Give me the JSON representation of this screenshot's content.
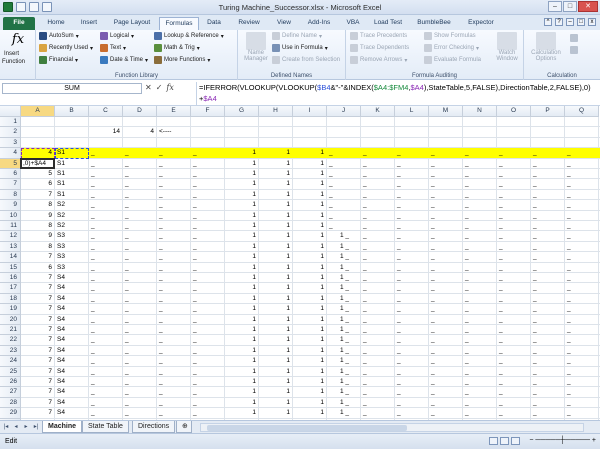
{
  "window": {
    "title": "Turing Machine_Successor.xlsx - Microsoft Excel"
  },
  "tabs": [
    "File",
    "Home",
    "Insert",
    "Page Layout",
    "Formulas",
    "Data",
    "Review",
    "View",
    "Add-Ins",
    "VBA",
    "Load Test",
    "BumbleBee",
    "Expector"
  ],
  "active_tab": "Formulas",
  "ribbon": {
    "insert_function": [
      "Insert",
      "Function"
    ],
    "library": {
      "autosum": "AutoSum",
      "recent": "Recently Used",
      "financial": "Financial",
      "logical": "Logical",
      "text": "Text",
      "datetime": "Date & Time",
      "lookup": "Lookup & Reference",
      "math": "Math & Trig",
      "more": "More Functions",
      "label": "Function Library"
    },
    "names": {
      "name_manager": [
        "Name",
        "Manager"
      ],
      "define_name": "Define Name",
      "use_in_formula": "Use in Formula",
      "create_from_selection": "Create from Selection",
      "label": "Defined Names"
    },
    "auditing": {
      "trace_precedents": "Trace Precedents",
      "trace_dependents": "Trace Dependents",
      "remove_arrows": "Remove Arrows",
      "show_formulas": "Show Formulas",
      "error_checking": "Error Checking",
      "evaluate_formula": "Evaluate Formula",
      "watch_window": [
        "Watch",
        "Window"
      ],
      "label": "Formula Auditing"
    },
    "calculation": {
      "options": [
        "Calculation",
        "Options"
      ],
      "label": "Calculation"
    }
  },
  "formula_bar": {
    "name_box": "SUM",
    "cancel": "✕",
    "enter": "✓",
    "fx": "fx",
    "formula_parts": [
      {
        "text": "=IFERROR(VLOOKUP(VLOOKUP(",
        "color": "black"
      },
      {
        "text": "$B4",
        "color": "blue"
      },
      {
        "text": "&\"-\"&INDEX(",
        "color": "black"
      },
      {
        "text": "$A4:$FM4",
        "color": "green"
      },
      {
        "text": ",",
        "color": "black"
      },
      {
        "text": "$A4",
        "color": "purple"
      },
      {
        "text": "),StateTable,5,FALSE),DirectionTable,2,FALSE),0)+",
        "color": "black"
      },
      {
        "text": "$A4",
        "color": "purple"
      }
    ]
  },
  "grid": {
    "columns": [
      "A",
      "B",
      "C",
      "D",
      "E",
      "F",
      "G",
      "H",
      "I",
      "J",
      "K",
      "L",
      "M",
      "N",
      "O",
      "P",
      "Q"
    ],
    "rows": [
      {
        "n": "1",
        "a": "",
        "b": "",
        "c": "",
        "d": "",
        "e": "",
        "g": "",
        "h": "",
        "i": "",
        "j": "",
        "rest": false
      },
      {
        "n": "2",
        "a": "",
        "b": "",
        "c": "14",
        "d": "4",
        "e": "<----",
        "g": "",
        "h": "",
        "i": "",
        "j": "",
        "rest": false
      },
      {
        "n": "3",
        "a": "",
        "b": "",
        "c": "",
        "d": "",
        "e": "",
        "g": "",
        "h": "",
        "i": "",
        "j": "",
        "rest": false
      },
      {
        "n": "4",
        "a": "4",
        "b": "S1",
        "c": "_",
        "d": "_",
        "e": "_",
        "f": "_",
        "g": "1",
        "h": "1",
        "i": "1",
        "j": "_",
        "rest": true
      },
      {
        "n": "5",
        "a": ",0)+$A4",
        "b": "S1",
        "c": "_",
        "d": "_",
        "e": "_",
        "f": "_",
        "g": "1",
        "h": "1",
        "i": "1",
        "j": "_",
        "rest": true
      },
      {
        "n": "6",
        "a": "5",
        "b": "S1",
        "c": "_",
        "d": "_",
        "e": "_",
        "f": "_",
        "g": "1",
        "h": "1",
        "i": "1",
        "j": "_",
        "rest": true
      },
      {
        "n": "7",
        "a": "6",
        "b": "S1",
        "c": "_",
        "d": "_",
        "e": "_",
        "f": "_",
        "g": "1",
        "h": "1",
        "i": "1",
        "j": "_",
        "rest": true
      },
      {
        "n": "8",
        "a": "7",
        "b": "S1",
        "c": "_",
        "d": "_",
        "e": "_",
        "f": "_",
        "g": "1",
        "h": "1",
        "i": "1",
        "j": "_",
        "rest": true
      },
      {
        "n": "9",
        "a": "8",
        "b": "S2",
        "c": "_",
        "d": "_",
        "e": "_",
        "f": "_",
        "g": "1",
        "h": "1",
        "i": "1",
        "j": "_",
        "rest": true
      },
      {
        "n": "10",
        "a": "9",
        "b": "S2",
        "c": "_",
        "d": "_",
        "e": "_",
        "f": "_",
        "g": "1",
        "h": "1",
        "i": "1",
        "j": "_",
        "rest": true
      },
      {
        "n": "11",
        "a": "8",
        "b": "S2",
        "c": "_",
        "d": "_",
        "e": "_",
        "f": "_",
        "g": "1",
        "h": "1",
        "i": "1",
        "j": "_",
        "rest": true
      },
      {
        "n": "12",
        "a": "9",
        "b": "S3",
        "c": "_",
        "d": "_",
        "e": "_",
        "f": "_",
        "g": "1",
        "h": "1",
        "i": "1",
        "j": "1 _",
        "rest": true
      },
      {
        "n": "13",
        "a": "8",
        "b": "S3",
        "c": "_",
        "d": "_",
        "e": "_",
        "f": "_",
        "g": "1",
        "h": "1",
        "i": "1",
        "j": "1 _",
        "rest": true
      },
      {
        "n": "14",
        "a": "7",
        "b": "S3",
        "c": "_",
        "d": "_",
        "e": "_",
        "f": "_",
        "g": "1",
        "h": "1",
        "i": "1",
        "j": "1 _",
        "rest": true
      },
      {
        "n": "15",
        "a": "6",
        "b": "S3",
        "c": "_",
        "d": "_",
        "e": "_",
        "f": "_",
        "g": "1",
        "h": "1",
        "i": "1",
        "j": "1 _",
        "rest": true
      },
      {
        "n": "16",
        "a": "7",
        "b": "S4",
        "c": "_",
        "d": "_",
        "e": "_",
        "f": "_",
        "g": "1",
        "h": "1",
        "i": "1",
        "j": "1 _",
        "rest": true
      },
      {
        "n": "17",
        "a": "7",
        "b": "S4",
        "c": "_",
        "d": "_",
        "e": "_",
        "f": "_",
        "g": "1",
        "h": "1",
        "i": "1",
        "j": "1 _",
        "rest": true
      },
      {
        "n": "18",
        "a": "7",
        "b": "S4",
        "c": "_",
        "d": "_",
        "e": "_",
        "f": "_",
        "g": "1",
        "h": "1",
        "i": "1",
        "j": "1 _",
        "rest": true
      },
      {
        "n": "19",
        "a": "7",
        "b": "S4",
        "c": "_",
        "d": "_",
        "e": "_",
        "f": "_",
        "g": "1",
        "h": "1",
        "i": "1",
        "j": "1 _",
        "rest": true
      },
      {
        "n": "20",
        "a": "7",
        "b": "S4",
        "c": "_",
        "d": "_",
        "e": "_",
        "f": "_",
        "g": "1",
        "h": "1",
        "i": "1",
        "j": "1 _",
        "rest": true
      },
      {
        "n": "21",
        "a": "7",
        "b": "S4",
        "c": "_",
        "d": "_",
        "e": "_",
        "f": "_",
        "g": "1",
        "h": "1",
        "i": "1",
        "j": "1 _",
        "rest": true
      },
      {
        "n": "22",
        "a": "7",
        "b": "S4",
        "c": "_",
        "d": "_",
        "e": "_",
        "f": "_",
        "g": "1",
        "h": "1",
        "i": "1",
        "j": "1 _",
        "rest": true
      },
      {
        "n": "23",
        "a": "7",
        "b": "S4",
        "c": "_",
        "d": "_",
        "e": "_",
        "f": "_",
        "g": "1",
        "h": "1",
        "i": "1",
        "j": "1 _",
        "rest": true
      },
      {
        "n": "24",
        "a": "7",
        "b": "S4",
        "c": "_",
        "d": "_",
        "e": "_",
        "f": "_",
        "g": "1",
        "h": "1",
        "i": "1",
        "j": "1 _",
        "rest": true
      },
      {
        "n": "25",
        "a": "7",
        "b": "S4",
        "c": "_",
        "d": "_",
        "e": "_",
        "f": "_",
        "g": "1",
        "h": "1",
        "i": "1",
        "j": "1 _",
        "rest": true
      },
      {
        "n": "26",
        "a": "7",
        "b": "S4",
        "c": "_",
        "d": "_",
        "e": "_",
        "f": "_",
        "g": "1",
        "h": "1",
        "i": "1",
        "j": "1 _",
        "rest": true
      },
      {
        "n": "27",
        "a": "7",
        "b": "S4",
        "c": "_",
        "d": "_",
        "e": "_",
        "f": "_",
        "g": "1",
        "h": "1",
        "i": "1",
        "j": "1 _",
        "rest": true
      },
      {
        "n": "28",
        "a": "7",
        "b": "S4",
        "c": "_",
        "d": "_",
        "e": "_",
        "f": "_",
        "g": "1",
        "h": "1",
        "i": "1",
        "j": "1 _",
        "rest": true
      },
      {
        "n": "29",
        "a": "7",
        "b": "S4",
        "c": "_",
        "d": "_",
        "e": "_",
        "f": "_",
        "g": "1",
        "h": "1",
        "i": "1",
        "j": "1 _",
        "rest": true
      },
      {
        "n": "30",
        "a": "7",
        "b": "S4",
        "c": "_",
        "d": "_",
        "e": "_",
        "f": "_",
        "g": "1",
        "h": "1",
        "i": "1",
        "j": "1 _",
        "rest": true
      }
    ],
    "filler": "_"
  },
  "sheets": [
    "Machine",
    "State Table",
    "Directions"
  ],
  "active_sheet": "Machine",
  "status": {
    "mode": "Edit"
  },
  "colors": {
    "highlight": "#ffff00",
    "ref_blue": "#2b50d9",
    "ref_green": "#168a3c",
    "ref_purple": "#8b29b6"
  }
}
